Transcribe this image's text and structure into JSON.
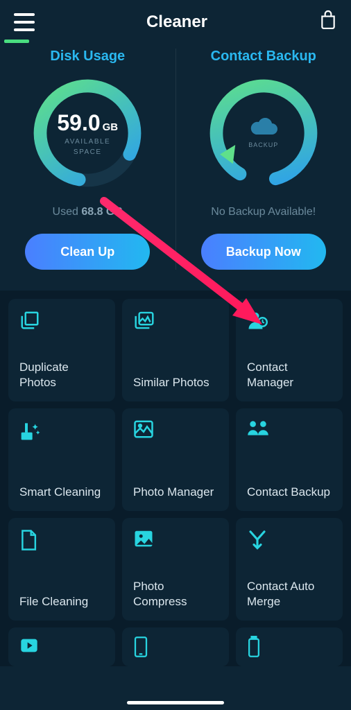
{
  "header": {
    "title": "Cleaner"
  },
  "diskUsage": {
    "title": "Disk Usage",
    "value": "59.0",
    "unit": "GB",
    "subLabel1": "AVAILABLE",
    "subLabel2": "SPACE",
    "usedLabel": "Used ",
    "usedValue": "68.8 GB",
    "button": "Clean Up"
  },
  "contactBackup": {
    "title": "Contact Backup",
    "backupLabel": "BACKUP",
    "status": "No Backup Available!",
    "button": "Backup Now"
  },
  "tiles": [
    {
      "label": "Duplicate Photos"
    },
    {
      "label": "Similar Photos"
    },
    {
      "label": "Contact Manager"
    },
    {
      "label": "Smart Cleaning"
    },
    {
      "label": "Photo Manager"
    },
    {
      "label": "Contact Backup"
    },
    {
      "label": "File Cleaning"
    },
    {
      "label": "Photo Compress"
    },
    {
      "label": "Contact Auto Merge"
    }
  ]
}
